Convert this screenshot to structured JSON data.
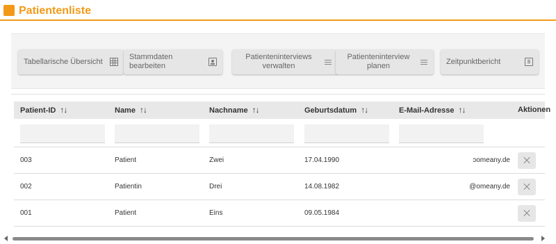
{
  "header": {
    "title": "Patientenliste",
    "accent_color": "#f29a17"
  },
  "toolbar": {
    "buttons": [
      {
        "label": "Tabellarische Übersicht",
        "icon": "table-icon"
      },
      {
        "label": "Stammdaten bearbeiten",
        "icon": "id-card-icon"
      },
      {
        "label": "Patienteninterviews verwalten",
        "icon": "list-icon"
      },
      {
        "label": "Patienteninterview planen",
        "icon": "list-icon"
      },
      {
        "label": "Zeitpunktbericht",
        "icon": "report-icon"
      }
    ]
  },
  "table": {
    "columns": [
      {
        "label": "Patient-ID",
        "sort_icon": "↑↓"
      },
      {
        "label": "Name",
        "sort_icon": "↑↓"
      },
      {
        "label": "Nachname",
        "sort_icon": "↑↓"
      },
      {
        "label": "Geburtsdatum",
        "sort_icon": "↑↓"
      },
      {
        "label": "E-Mail-Adresse",
        "sort_icon": "↑↓"
      },
      {
        "label": "Aktionen"
      }
    ],
    "filters": [
      "",
      "",
      "",
      "",
      ""
    ],
    "rows": [
      {
        "id": "003",
        "name": "Patient",
        "nachname": "Zwei",
        "geburtsdatum": "17.04.1990",
        "email": "ɔomeany.de"
      },
      {
        "id": "002",
        "name": "Patientin",
        "nachname": "Drei",
        "geburtsdatum": "14.08.1982",
        "email": "@omeany.de"
      },
      {
        "id": "001",
        "name": "Patient",
        "nachname": "Eins",
        "geburtsdatum": "09.05.1984",
        "email": ""
      }
    ]
  }
}
